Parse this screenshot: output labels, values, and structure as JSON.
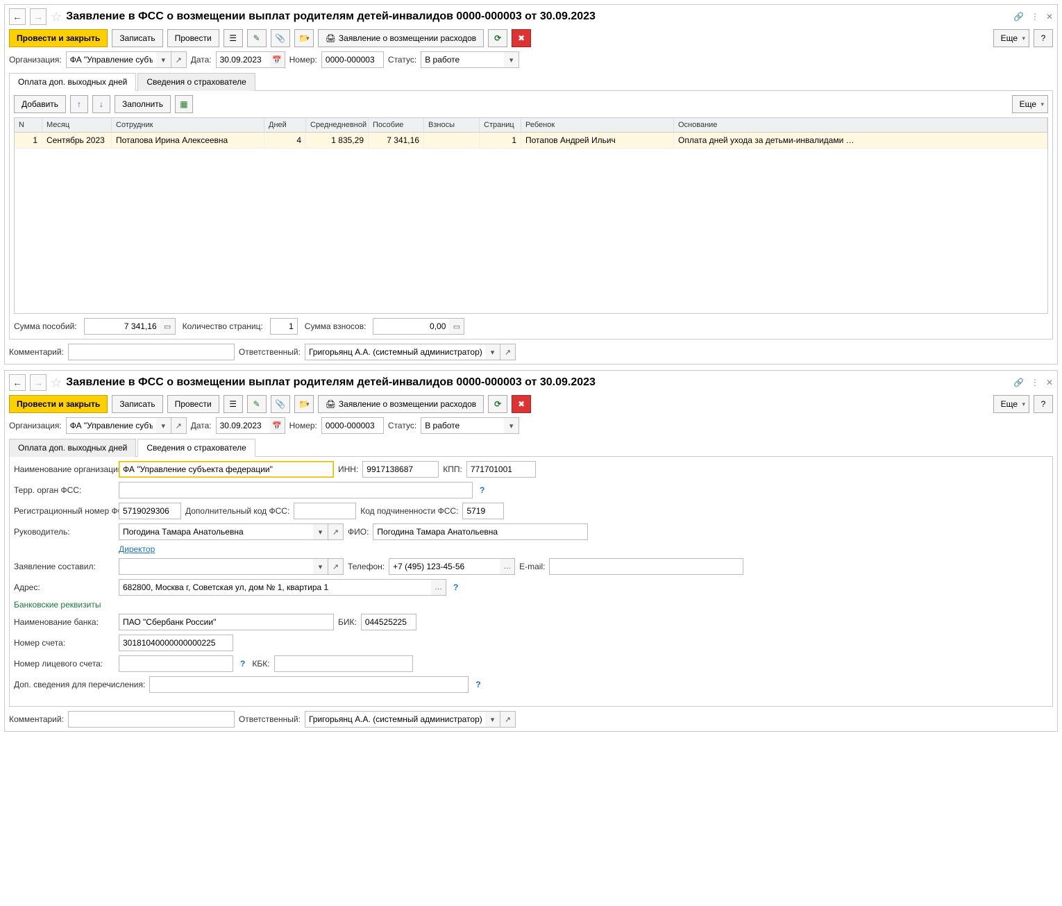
{
  "title": "Заявление в ФСС о возмещении выплат родителям детей-инвалидов 0000-000003 от 30.09.2023",
  "toolbar": {
    "postClose": "Провести и закрыть",
    "write": "Записать",
    "post": "Провести",
    "report": "Заявление о возмещении расходов",
    "more": "Еще"
  },
  "hdr": {
    "org_lbl": "Организация:",
    "org": "ФА \"Управление субъекта",
    "date_lbl": "Дата:",
    "date": "30.09.2023",
    "num_lbl": "Номер:",
    "num": "0000-000003",
    "status_lbl": "Статус:",
    "status": "В работе"
  },
  "tabs": {
    "t1": "Оплата доп. выходных дней",
    "t2": "Сведения о страхователе"
  },
  "tbtoolbar": {
    "add": "Добавить",
    "fill": "Заполнить"
  },
  "cols": {
    "n": "N",
    "month": "Месяц",
    "emp": "Сотрудник",
    "days": "Дней",
    "avg": "Среднедневной",
    "benefit": "Пособие",
    "contr": "Взносы",
    "pages": "Страниц",
    "child": "Ребенок",
    "basis": "Основание"
  },
  "row": {
    "n": "1",
    "month": "Сентябрь 2023",
    "emp": "Потапова Ирина Алексеевна",
    "days": "4",
    "avg": "1 835,29",
    "benefit": "7 341,16",
    "contr": "",
    "pages": "1",
    "child": "Потапов Андрей Ильич",
    "basis": "Оплата дней ухода за детьми-инвалидами …"
  },
  "totals": {
    "sum_lbl": "Сумма пособий:",
    "sum": "7 341,16",
    "pages_lbl": "Количество страниц:",
    "pages": "1",
    "contr_lbl": "Сумма взносов:",
    "contr": "0,00"
  },
  "footer": {
    "comment_lbl": "Комментарий:",
    "resp_lbl": "Ответственный:",
    "resp": "Григорьянц А.А. (системный администратор)"
  },
  "ins": {
    "name_lbl": "Наименование организации:",
    "name": "ФА \"Управление субъекта федерации\"",
    "inn_lbl": "ИНН:",
    "inn": "9917138687",
    "kpp_lbl": "КПП:",
    "kpp": "771701001",
    "terr_lbl": "Терр. орган ФСС:",
    "reg_lbl": "Регистрационный номер ФСС:",
    "reg": "5719029306",
    "dop_lbl": "Дополнительный код ФСС:",
    "pod_lbl": "Код подчиненности ФСС:",
    "pod": "5719",
    "ruk_lbl": "Руководитель:",
    "ruk": "Погодина Тамара Анатольевна",
    "fio_lbl": "ФИО:",
    "fio": "Погодина Тамара Анатольевна",
    "pos": "Директор",
    "compiled_lbl": "Заявление составил:",
    "phone_lbl": "Телефон:",
    "phone": "+7 (495) 123-45-56",
    "email_lbl": "E-mail:",
    "addr_lbl": "Адрес:",
    "addr": "682800, Москва г, Советская ул, дом № 1, квартира 1",
    "bank_sec": "Банковские реквизиты",
    "bank_lbl": "Наименование банка:",
    "bank": "ПАО \"Сбербанк России\"",
    "bik_lbl": "БИК:",
    "bik": "044525225",
    "acc_lbl": "Номер счета:",
    "acc": "30181040000000000225",
    "pers_lbl": "Номер лицевого счета:",
    "kbk_lbl": "КБК:",
    "extra_lbl": "Доп. сведения для перечисления:"
  }
}
